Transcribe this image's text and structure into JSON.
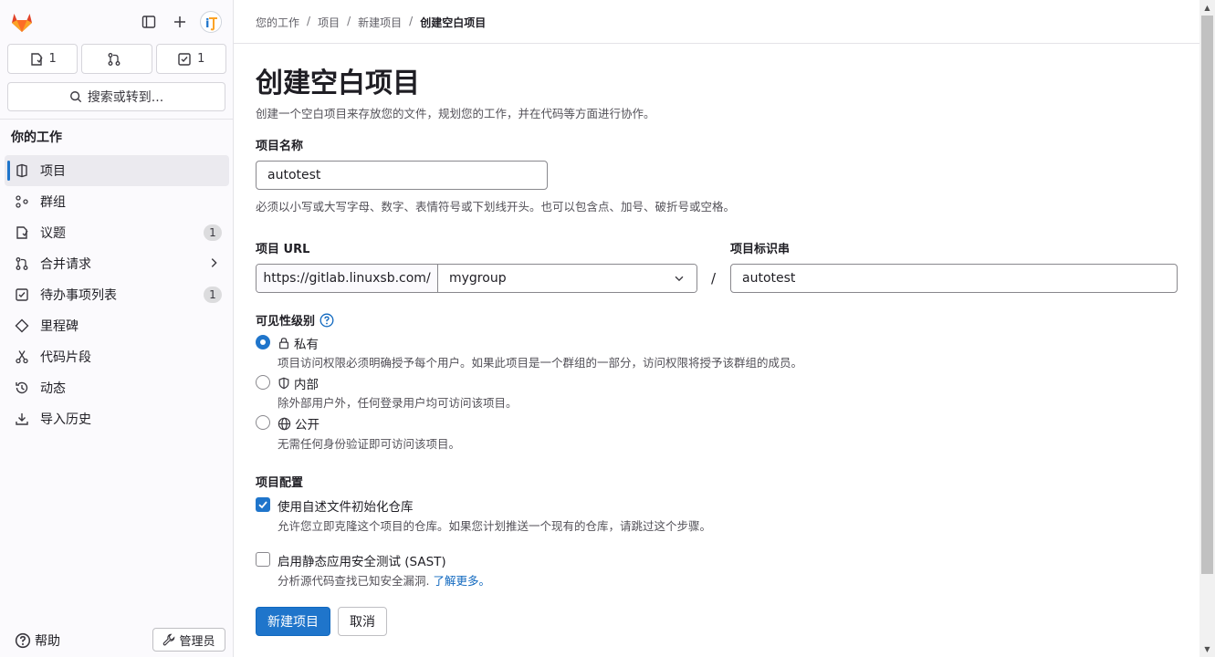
{
  "sidebar": {
    "counters": {
      "issues": "1",
      "merge_requests": "",
      "todos": "1"
    },
    "search_label": "搜索或转到...",
    "section_title": "你的工作",
    "items": [
      {
        "label": "项目",
        "icon": "project-icon",
        "active": true
      },
      {
        "label": "群组",
        "icon": "group-icon"
      },
      {
        "label": "议题",
        "icon": "issues-icon",
        "badge": "1"
      },
      {
        "label": "合并请求",
        "icon": "merge-request-icon",
        "chevron": true
      },
      {
        "label": "待办事项列表",
        "icon": "todo-icon",
        "badge": "1"
      },
      {
        "label": "里程碑",
        "icon": "milestone-icon"
      },
      {
        "label": "代码片段",
        "icon": "snippet-icon"
      },
      {
        "label": "动态",
        "icon": "activity-icon"
      },
      {
        "label": "导入历史",
        "icon": "import-icon"
      }
    ],
    "help_label": "帮助",
    "admin_label": "管理员"
  },
  "breadcrumb": [
    "您的工作",
    "项目",
    "新建项目",
    "创建空白项目"
  ],
  "page": {
    "title": "创建空白项目",
    "description": "创建一个空白项目来存放您的文件，规划您的工作，并在代码等方面进行协作。"
  },
  "form": {
    "name_label": "项目名称",
    "name_value": "autotest",
    "name_help": "必须以小写或大写字母、数字、表情符号或下划线开头。也可以包含点、加号、破折号或空格。",
    "url_label": "项目 URL",
    "url_prefix": "https://gitlab.linuxsb.com/",
    "namespace_value": "mygroup",
    "slug_label": "项目标识串",
    "slug_value": "autotest",
    "visibility_label": "可见性级别",
    "visibility": [
      {
        "label": "私有",
        "desc": "项目访问权限必须明确授予每个用户。如果此项目是一个群组的一部分，访问权限将授予该群组的成员。",
        "selected": true
      },
      {
        "label": "内部",
        "desc": "除外部用户外，任何登录用户均可访问该项目。",
        "selected": false
      },
      {
        "label": "公开",
        "desc": "无需任何身份验证即可访问该项目。",
        "selected": false
      }
    ],
    "config_label": "项目配置",
    "readme_label": "使用自述文件初始化仓库",
    "readme_desc": "允许您立即克隆这个项目的仓库。如果您计划推送一个现有的仓库，请跳过这个步骤。",
    "readme_checked": true,
    "sast_label": "启用静态应用安全测试 (SAST)",
    "sast_desc": "分析源代码查找已知安全漏洞.",
    "sast_link": "了解更多。",
    "sast_checked": false,
    "submit_label": "新建项目",
    "cancel_label": "取消"
  }
}
